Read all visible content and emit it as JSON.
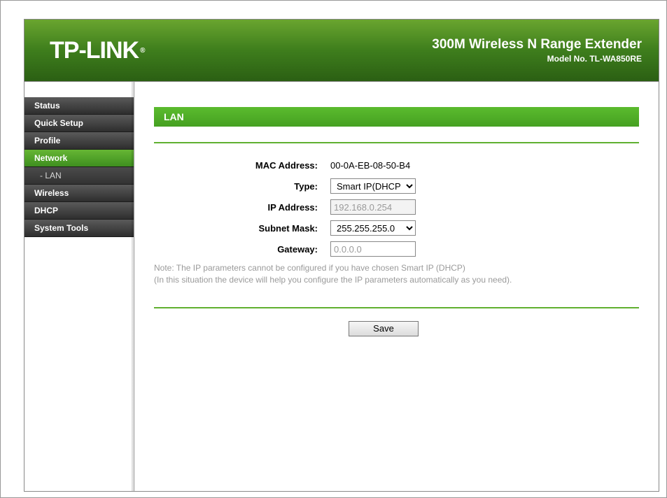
{
  "header": {
    "brand": "TP-LINK",
    "reg": "®",
    "title": "300M Wireless N Range Extender",
    "model": "Model No. TL-WA850RE"
  },
  "nav": {
    "status": "Status",
    "quick_setup": "Quick Setup",
    "profile": "Profile",
    "network": "Network",
    "lan": "- LAN",
    "wireless": "Wireless",
    "dhcp": "DHCP",
    "system_tools": "System Tools"
  },
  "section": {
    "title": "LAN"
  },
  "form": {
    "mac_label": "MAC Address:",
    "mac_value": "00-0A-EB-08-50-B4",
    "type_label": "Type:",
    "type_value": "Smart IP(DHCP)",
    "ip_label": "IP Address:",
    "ip_value": "192.168.0.254",
    "mask_label": "Subnet Mask:",
    "mask_value": "255.255.255.0",
    "gateway_label": "Gateway:",
    "gateway_value": "0.0.0.0",
    "note_line1": "Note: The IP parameters cannot be configured if you have chosen Smart IP (DHCP)",
    "note_line2": "(In this situation the device will help you configure the IP parameters automatically as you need).",
    "save_label": "Save"
  }
}
